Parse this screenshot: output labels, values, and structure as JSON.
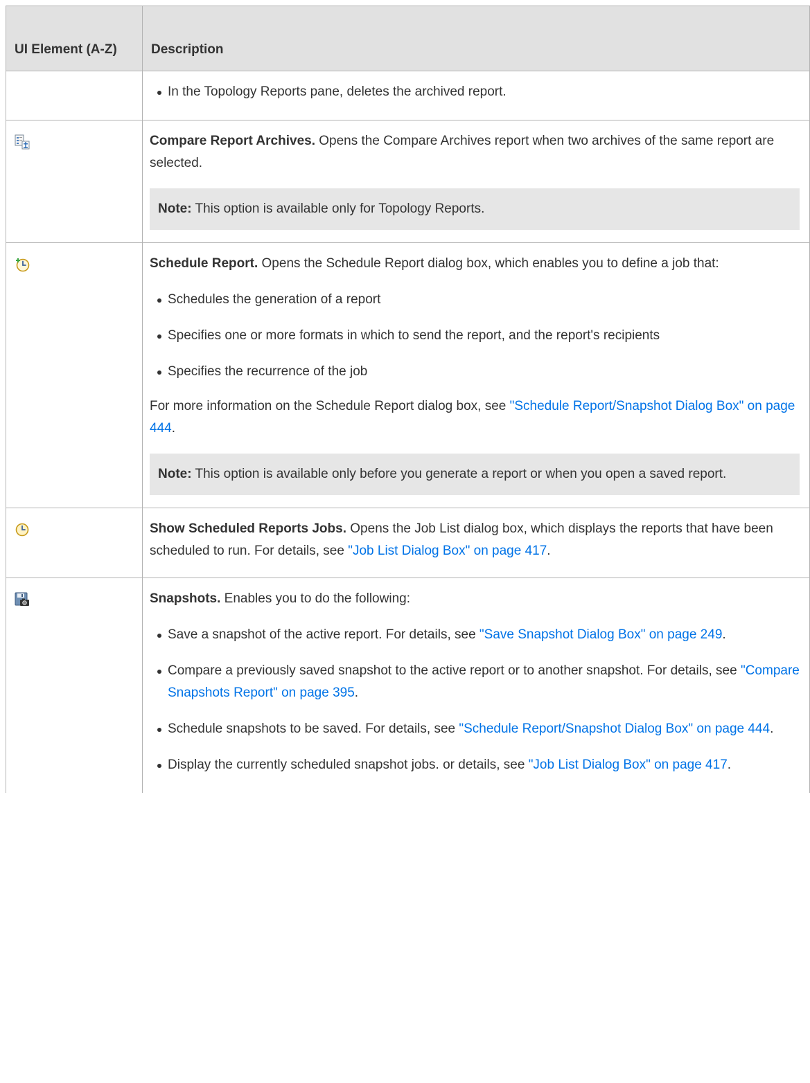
{
  "header": {
    "ui_element": "UI Element (A-Z)",
    "description": "Description"
  },
  "rows": {
    "delete_archive": {
      "bullet": "In the Topology Reports pane, deletes the archived report."
    },
    "compare_archives": {
      "icon": "compare-archives-icon",
      "title": "Compare Report Archives.",
      "text": " Opens the Compare Archives report when two archives of the same report are selected.",
      "note_label": "Note:",
      "note_text": " This option is available only for Topology Reports."
    },
    "schedule_report": {
      "icon": "schedule-report-icon",
      "title": "Schedule Report.",
      "text": " Opens the Schedule Report dialog box, which enables you to define a job that:",
      "bullets": [
        "Schedules the generation of a report",
        "Specifies one or more formats in which to send the report, and the report's recipients",
        "Specifies the recurrence of the job"
      ],
      "more_prefix": "For more information on the Schedule Report dialog box, see ",
      "more_link": "\"Schedule Report/Snapshot Dialog Box\" on page 444",
      "more_suffix": ".",
      "note_label": "Note:",
      "note_text": " This option is available only before you generate a report or when you open a saved report."
    },
    "show_jobs": {
      "icon": "clock-icon",
      "title": "Show Scheduled Reports Jobs.",
      "text": " Opens the Job List dialog box, which displays the reports that have been scheduled to run. For details, see ",
      "link": "\"Job List Dialog Box\" on page 417",
      "suffix": "."
    },
    "snapshots": {
      "icon": "snapshot-icon",
      "title": "Snapshots.",
      "text": " Enables you to do the following:",
      "bullets": [
        {
          "text": "Save a snapshot of the active report. For details, see ",
          "link": "\"Save Snapshot Dialog Box\" on page 249",
          "suffix": "."
        },
        {
          "text": "Compare a previously saved snapshot to the active report or to another snapshot. For details, see ",
          "link": "\"Compare Snapshots Report\" on page 395",
          "suffix": "."
        },
        {
          "text": "Schedule snapshots to be saved. For details, see ",
          "link": "\"Schedule Report/Snapshot Dialog Box\" on page 444",
          "suffix": "."
        },
        {
          "text": "Display the currently scheduled snapshot jobs. or details, see ",
          "link": "\"Job List Dialog Box\" on page 417",
          "suffix": "."
        }
      ]
    }
  },
  "colors": {
    "link": "#0073e7",
    "header_bg": "#e1e1e1",
    "note_bg": "#e6e6e6",
    "border": "#b3b3b3"
  }
}
